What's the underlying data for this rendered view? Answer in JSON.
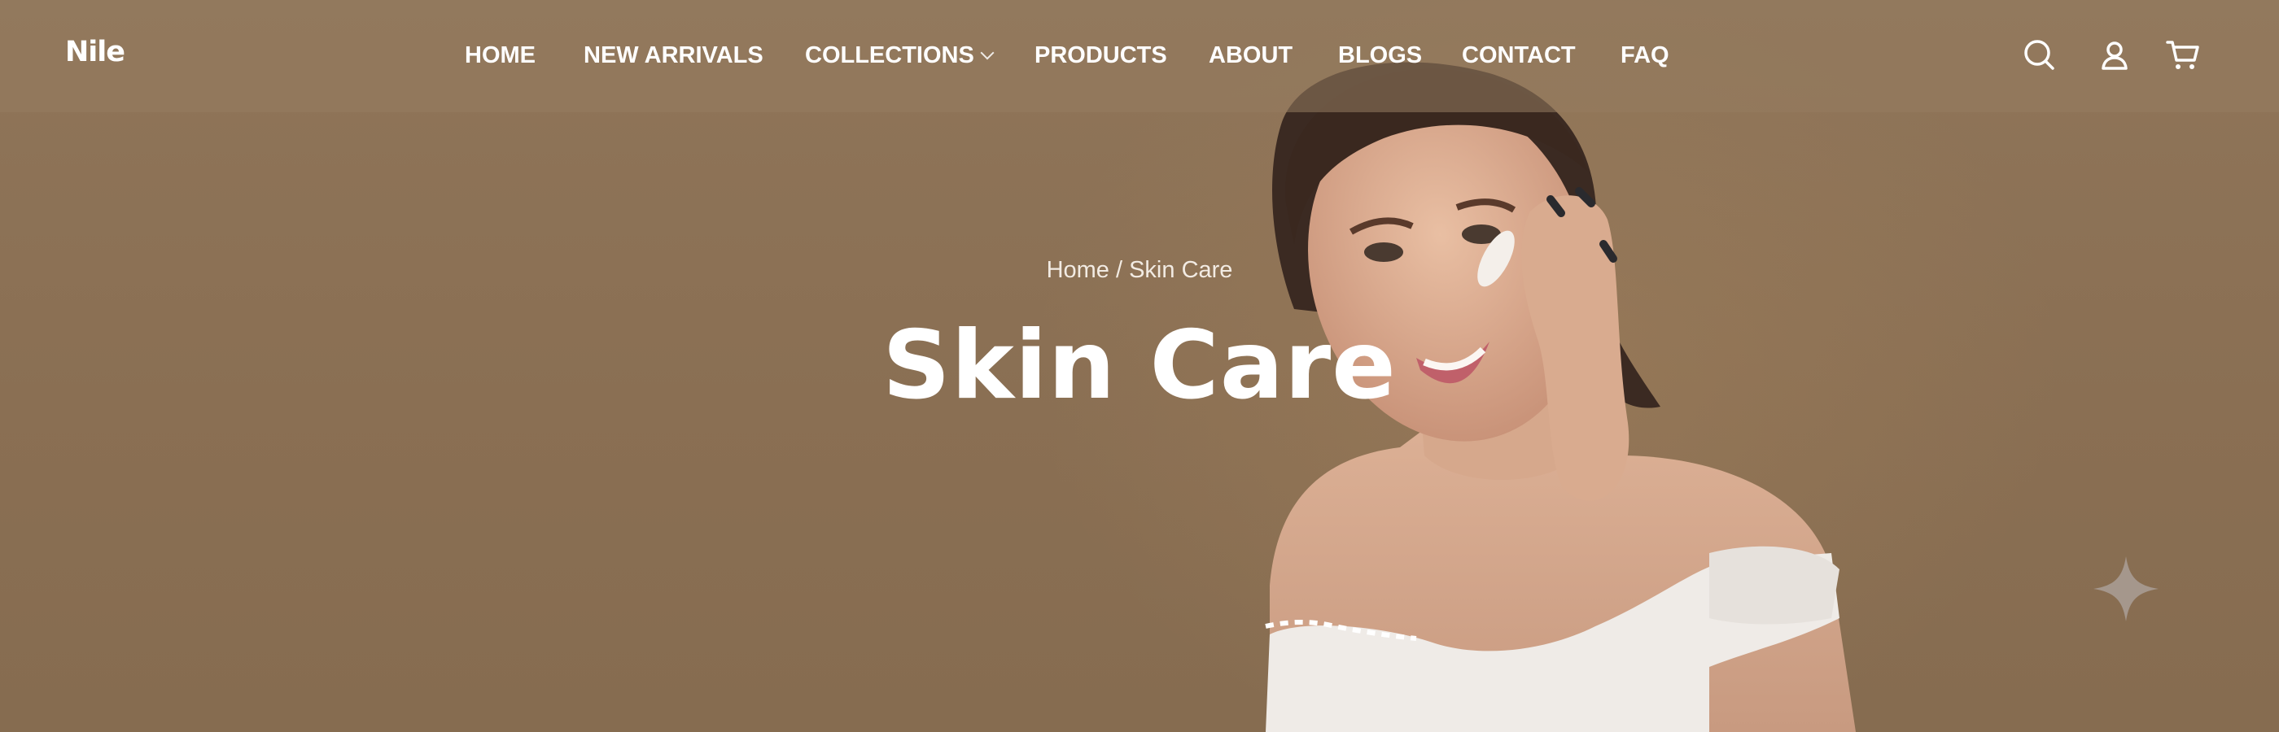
{
  "brand": {
    "logo_text": "Nile"
  },
  "nav": {
    "items": [
      {
        "label": "HOME"
      },
      {
        "label": "NEW ARRIVALS"
      },
      {
        "label": "COLLECTIONS"
      },
      {
        "label": "PRODUCTS"
      },
      {
        "label": "ABOUT"
      },
      {
        "label": "BLOGS"
      },
      {
        "label": "CONTACT"
      },
      {
        "label": "FAQ"
      }
    ]
  },
  "header_icons": [
    "search-icon",
    "user-icon",
    "cart-icon"
  ],
  "breadcrumb": {
    "home": "Home",
    "separator": " / ",
    "current": "Skin Care"
  },
  "hero": {
    "title": "Skin Care"
  },
  "colors": {
    "hero_background": "#8a6f53",
    "header_overlay": "#967c60",
    "text": "#ffffff"
  }
}
